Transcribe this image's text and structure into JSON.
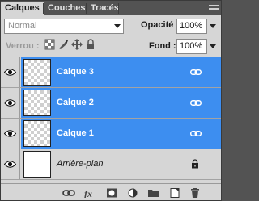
{
  "tabs": [
    {
      "label": "Calques",
      "active": true
    },
    {
      "label": "Couches",
      "active": false
    },
    {
      "label": "Tracés",
      "active": false
    }
  ],
  "blend_mode": {
    "value": "Normal"
  },
  "opacity": {
    "label": "Opacité :",
    "value": "100%"
  },
  "lock": {
    "label": "Verrou :"
  },
  "fill": {
    "label": "Fond :",
    "value": "100%"
  },
  "layers": [
    {
      "name": "Calque 3",
      "selected": true,
      "linked": true
    },
    {
      "name": "Calque 2",
      "selected": true,
      "linked": true
    },
    {
      "name": "Calque 1",
      "selected": true,
      "linked": true
    },
    {
      "name": "Arrière-plan",
      "selected": false,
      "locked": true
    }
  ],
  "colors": {
    "selection": "#3d8ef0",
    "panel_bg": "#d6d6d6",
    "tab_bar": "#535353"
  },
  "bottom_tools": [
    "link-layers-icon",
    "fx-icon",
    "layer-mask-icon",
    "adjustment-layer-icon",
    "new-group-icon",
    "new-layer-icon",
    "delete-layer-icon"
  ]
}
